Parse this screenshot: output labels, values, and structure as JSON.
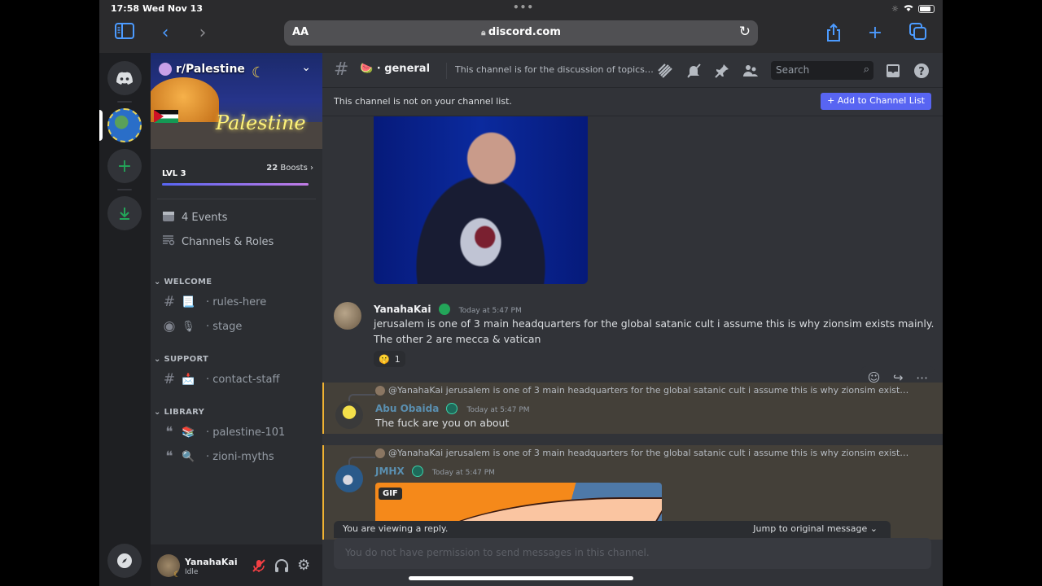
{
  "status_bar": {
    "time": "17:58",
    "date": "Wed Nov 13",
    "battery_percent": 80
  },
  "browser": {
    "text_size_label": "AA",
    "url": "discord.com"
  },
  "server": {
    "name": "r/Palestine",
    "banner_text": "Palestine",
    "level_label": "LVL 3",
    "boosts_count": "22",
    "boosts_label": "Boosts",
    "boost_progress": 1.0,
    "events_label": "4 Events",
    "channels_roles_label": "Channels & Roles"
  },
  "categories": [
    {
      "name": "WELCOME",
      "channels": [
        {
          "type": "text",
          "emoji": "📃",
          "name": "rules-here"
        },
        {
          "type": "stage",
          "emoji": "🎙",
          "name": "stage"
        }
      ]
    },
    {
      "name": "SUPPORT",
      "channels": [
        {
          "type": "text-locked",
          "emoji": "📩",
          "name": "contact-staff"
        }
      ]
    },
    {
      "name": "LIBRARY",
      "channels": [
        {
          "type": "forum",
          "emoji": "📚",
          "name": "palestine-101"
        },
        {
          "type": "forum",
          "emoji": "🔍",
          "name": "zioni-myths"
        }
      ]
    }
  ],
  "user_panel": {
    "username": "YanahaKai",
    "status": "Idle"
  },
  "channel_header": {
    "emoji": "🍉",
    "name": "general",
    "topic": "This channel is for the discussion of topics r...",
    "search_placeholder": "Search"
  },
  "notice": {
    "text": "This channel is not on your channel list.",
    "button_label": "Add to Channel List"
  },
  "messages": [
    {
      "author": "YanahaKai",
      "author_color": "#f2f3f5",
      "timestamp": "Today at 5:47 PM",
      "lines": [
        "jerusalem is one of 3 main headquarters for the global satanic cult i assume this is why zionsim exists mainly.",
        "The other 2 are mecca & vatican"
      ],
      "reaction_count": "1"
    },
    {
      "reply_to": "@YanahaKai jerusalem is one of 3 main headquarters for the global satanic cult i assume this is why zionsim exists mainly...",
      "author": "Abu Obaida",
      "author_color": "#5a8fb0",
      "timestamp": "Today at 5:47 PM",
      "text": "The fuck are you on about"
    },
    {
      "reply_to": "@YanahaKai jerusalem is one of 3 main headquarters for the global satanic cult i assume this is why zionsim exists mainly...",
      "author": "JMHX",
      "author_color": "#5a8fb0",
      "timestamp": "Today at 5:47 PM",
      "gif_label": "GIF"
    }
  ],
  "reply_bar": {
    "text": "You are viewing a reply.",
    "jump_label": "Jump to original message"
  },
  "composer": {
    "placeholder": "You do not have permission to send messages in this channel."
  }
}
